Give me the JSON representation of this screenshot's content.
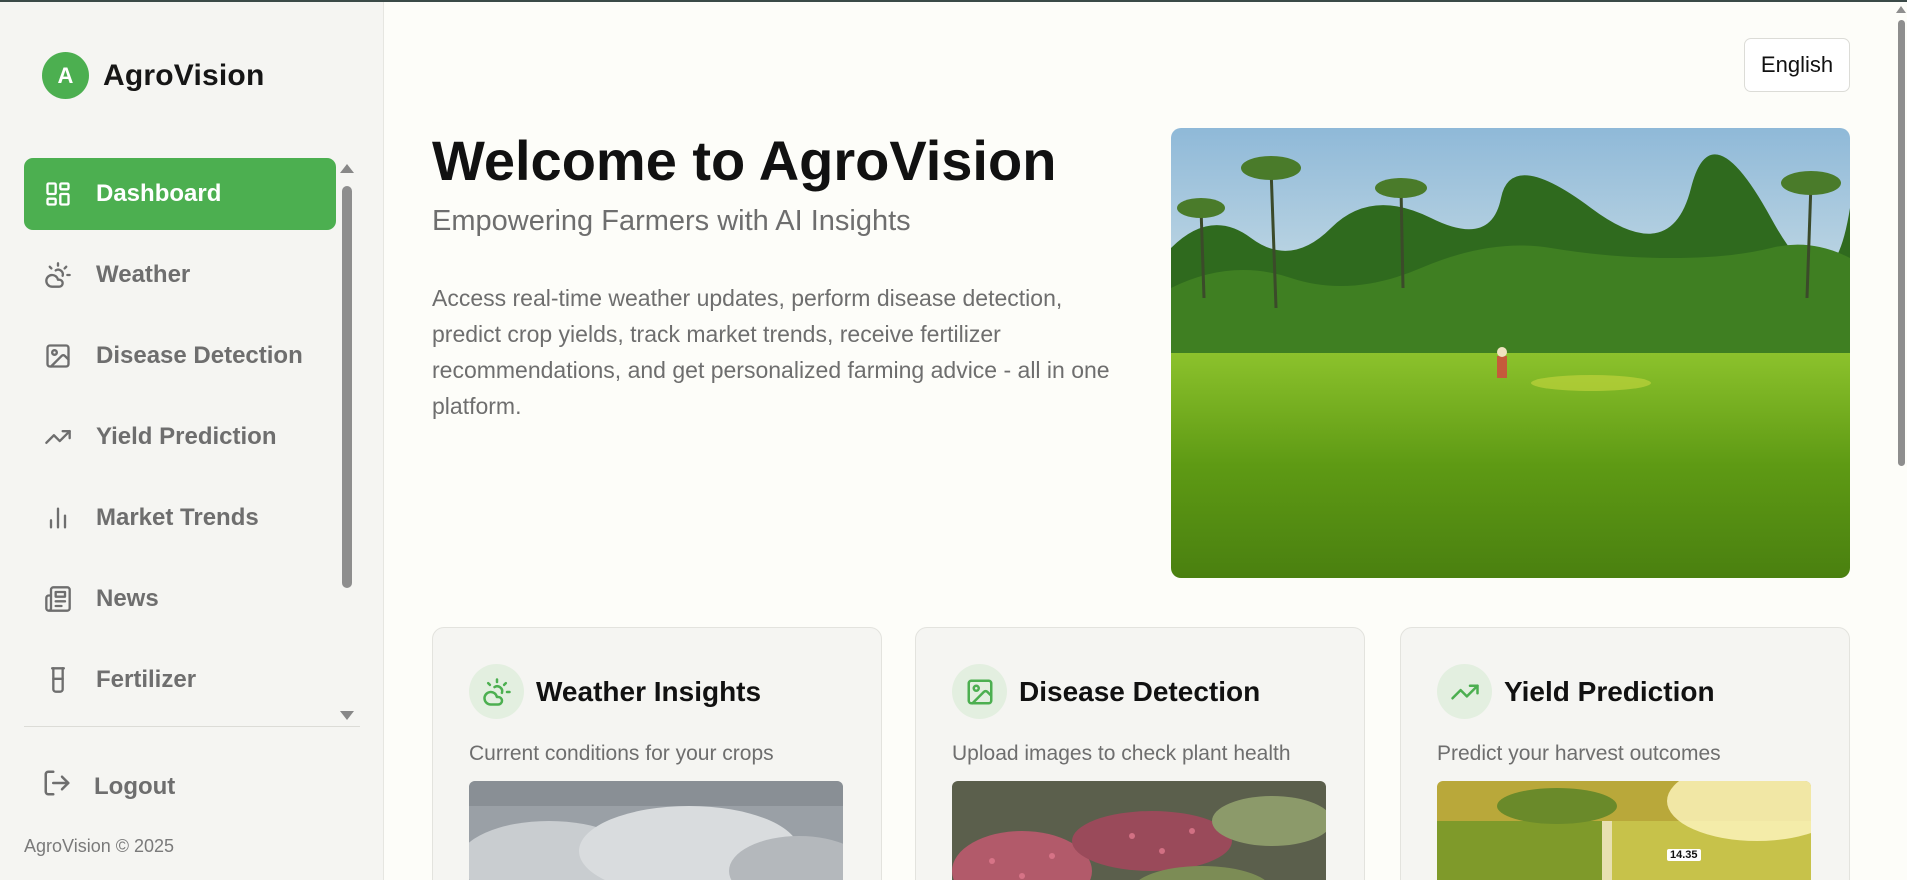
{
  "app": {
    "logo_letter": "A",
    "name": "AgroVision"
  },
  "sidebar": {
    "items": [
      {
        "label": "Dashboard",
        "icon": "dashboard-icon",
        "active": true
      },
      {
        "label": "Weather",
        "icon": "weather-icon"
      },
      {
        "label": "Disease Detection",
        "icon": "image-icon"
      },
      {
        "label": "Yield Prediction",
        "icon": "trending-up-icon"
      },
      {
        "label": "Market Trends",
        "icon": "bar-chart-icon"
      },
      {
        "label": "News",
        "icon": "newspaper-icon"
      },
      {
        "label": "Fertilizer",
        "icon": "flask-icon"
      }
    ],
    "logout_label": "Logout",
    "copyright": "AgroVision © 2025"
  },
  "header": {
    "language": "English"
  },
  "hero": {
    "title": "Welcome to AgroVision",
    "subtitle": "Empowering Farmers with AI Insights",
    "description": "Access real-time weather updates, perform disease detection, predict crop yields, track market trends, receive fertilizer recommendations, and get personalized farming advice - all in one platform."
  },
  "cards": [
    {
      "title": "Weather Insights",
      "description": "Current conditions for your crops",
      "icon": "weather-icon"
    },
    {
      "title": "Disease Detection",
      "description": "Upload images to check plant health",
      "icon": "image-icon"
    },
    {
      "title": "Yield Prediction",
      "description": "Predict your harvest outcomes",
      "icon": "trending-up-icon",
      "image_overlay": "14.35"
    }
  ],
  "colors": {
    "accent": "#4caf50",
    "accent_light": "#e3efe0",
    "muted_text": "#6e6e6e"
  }
}
